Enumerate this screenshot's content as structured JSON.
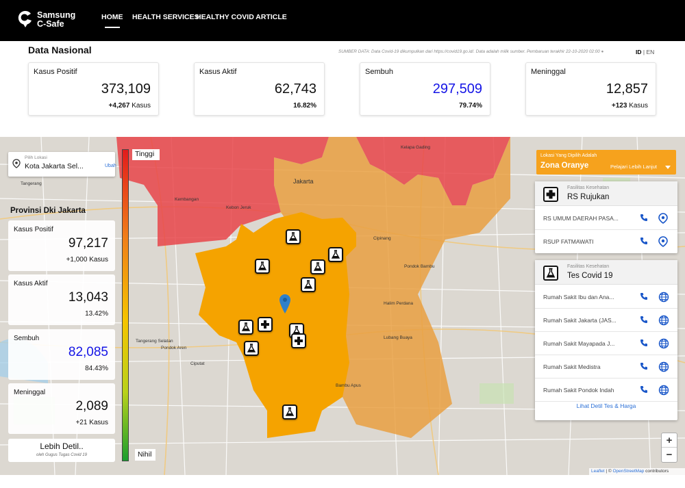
{
  "nav": {
    "brand_line1": "Samsung",
    "brand_line2": "C-Safe",
    "items": [
      {
        "label": "HOME",
        "active": true
      },
      {
        "label": "HEALTH SERVICES",
        "active": false
      },
      {
        "label": "HEALTHY COVID ARTICLE",
        "active": false
      }
    ]
  },
  "national": {
    "title": "Data Nasional",
    "source": "SUMBER DATA: Data Covid-19 dikumpulkan dari https://covid19.go.id/. Data adalah milik sumber. Pembaruan terakhir 22-10-2020 02:00",
    "lang_id": "ID",
    "lang_sep": "|",
    "lang_en": "EN",
    "cards": [
      {
        "label": "Kasus Positif",
        "value": "373,109",
        "sub_bold": "+4,267",
        "sub_unit": " Kasus",
        "color": "#111111"
      },
      {
        "label": "Kasus Aktif",
        "value": "62,743",
        "sub_bold": "16.82%",
        "sub_unit": "",
        "color": "#111111"
      },
      {
        "label": "Sembuh",
        "value": "297,509",
        "sub_bold": "79.74%",
        "sub_unit": "",
        "color": "#1414e6"
      },
      {
        "label": "Meninggal",
        "value": "12,857",
        "sub_bold": "+123",
        "sub_unit": " Kasus",
        "color": "#111111"
      }
    ]
  },
  "location": {
    "label": "Pilih Lokasi",
    "city": "Kota Jakarta Sel...",
    "change": "Ubah"
  },
  "province": {
    "title": "Provinsi Dki Jakarta",
    "cards": [
      {
        "label": "Kasus Positif",
        "value": "97,217",
        "sub": "+1,000 Kasus"
      },
      {
        "label": "Kasus Aktif",
        "value": "13,043",
        "sub": "13.42%"
      },
      {
        "label": "Sembuh",
        "value": "82,085",
        "sub": "84.43%"
      },
      {
        "label": "Meninggal",
        "value": "2,089",
        "sub": "+21 Kasus"
      }
    ],
    "more": "Lebih Detil..",
    "more_sub": "oleh Gugus Tugas Covid 19"
  },
  "scale": {
    "top": "Tinggi",
    "bottom": "Nihil"
  },
  "zone": {
    "small": "Lokasi Yang Dipilih Adalah",
    "name": "Zona Oranye",
    "learn": "Pelajari Lebih Lanjut",
    "color": "#f6a21d"
  },
  "rujukan": {
    "small": "Fasilitas Kesehatan",
    "name": "RS Rujukan",
    "items": [
      "RS UMUM DAERAH PASA...",
      "RSUP FATMAWATI"
    ]
  },
  "tes": {
    "small": "Fasilitas Kesehatan",
    "name": "Tes Covid 19",
    "items": [
      "Rumah Sakit Ibu dan Ana...",
      "Rumah Sakit Jakarta (JAS...",
      "Rumah Sakit Mayapada J...",
      "Rumah Sakit Medistra",
      "Rumah Sakit Pondok Indah"
    ],
    "more": "Lihat Detil Tes & Harga"
  },
  "map": {
    "zoom_in": "+",
    "zoom_out": "−",
    "attr_leaflet": "Leaflet",
    "attr_sep": " | © ",
    "attr_osm": "OpenStreetMap",
    "attr_tail": " contributors",
    "labels": [
      "Tangerang",
      "Jakarta",
      "Kembangan",
      "Kebon Jeruk",
      "Kelapa Gading",
      "Cipinang",
      "Pondok Bambu",
      "Halim Perdana",
      "Lubang Buaya",
      "Pondok Aren",
      "Ciputat",
      "Bambu Apus",
      "Tangerang Selatan"
    ]
  },
  "colors": {
    "red_zone": "#e8454a",
    "orange_zone": "#f5a300",
    "light_orange": "#eaa24a",
    "accent_blue": "#1414e6"
  }
}
